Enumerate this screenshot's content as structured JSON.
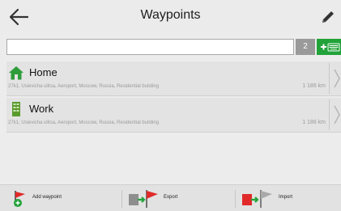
{
  "header": {
    "title": "Waypoints"
  },
  "search": {
    "value": "",
    "placeholder": ""
  },
  "count_badge": "2",
  "waypoints": [
    {
      "name": "Home",
      "address": "27k1, Usievicha ulitsa, Aeroport, Moscow, Russia, Residential building",
      "distance": "1 186 km",
      "icon": "house-icon"
    },
    {
      "name": "Work",
      "address": "27k1, Usievicha ulitsa, Aeroport, Moscow, Russia, Residential building",
      "distance": "1 186 km",
      "icon": "office-building-icon"
    }
  ],
  "toolbar": {
    "add_label": "Add waypoint",
    "export_label": "Export",
    "import_label": "Import"
  },
  "colors": {
    "accent_green": "#22a33a",
    "flag_red": "#e02a2a",
    "home_icon": "#2e9c3a",
    "work_icon": "#5a9a2e"
  }
}
